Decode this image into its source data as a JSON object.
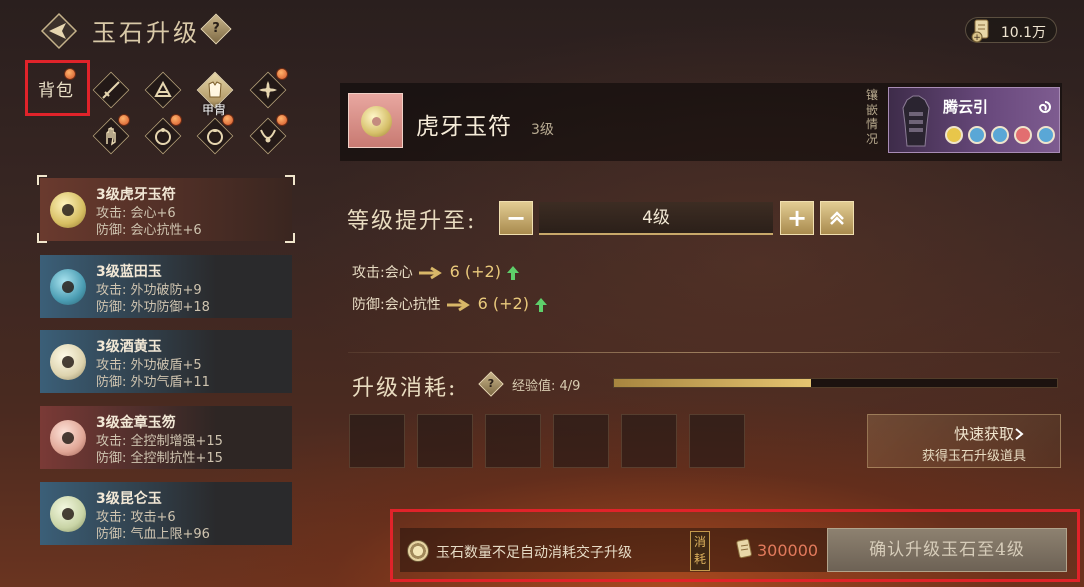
{
  "header": {
    "title": "玉石升级",
    "help_glyph": "?",
    "currency_value": "10.1万"
  },
  "categories": {
    "bag_label": "背包",
    "armor_label": "甲胄"
  },
  "jade_list": [
    {
      "name": "3级虎牙玉符",
      "attr1": "攻击: 会心+6",
      "attr2": "防御: 会心抗性+6",
      "color": "#d8c46a"
    },
    {
      "name": "3级蓝田玉",
      "attr1": "攻击: 外功破防+9",
      "attr2": "防御: 外功防御+18",
      "color": "#5fa7b8"
    },
    {
      "name": "3级酒黄玉",
      "attr1": "攻击: 外功破盾+5",
      "attr2": "防御: 外功气盾+11",
      "color": "#e5dcb8"
    },
    {
      "name": "3级金章玉笏",
      "attr1": "攻击: 全控制增强+15",
      "attr2": "防御: 全控制抗性+15",
      "color": "#e7b3a4"
    },
    {
      "name": "3级昆仑玉",
      "attr1": "攻击: 攻击+6",
      "attr2": "防御: 气血上限+96",
      "color": "#cfd8b0"
    }
  ],
  "selected": {
    "name": "虎牙玉符",
    "level": "3级"
  },
  "inlay": {
    "label": "镶嵌情况",
    "name": "腾云引",
    "socket_colors": [
      "#e8c64a",
      "#5aa7d6",
      "#5aa7d6",
      "#e26e70",
      "#5aa7d6"
    ]
  },
  "upgrade": {
    "label": "等级提升至:",
    "minus": "−",
    "plus": "+",
    "target_level": "4级",
    "stats": [
      {
        "name": "攻击:会心",
        "value": "6 (+2)"
      },
      {
        "name": "防御:会心抗性",
        "value": "6 (+2)"
      }
    ]
  },
  "cost": {
    "label": "升级消耗:",
    "exp_label": "经验值:",
    "exp_value": "4/9",
    "exp_fraction": 0.444,
    "slot_count": 6
  },
  "quick": {
    "title": "快速获取",
    "subtitle": "获得玉石升级道具"
  },
  "bottom": {
    "auto_text": "玉石数量不足自动消耗交子升级",
    "consume_tag": "消耗",
    "cost_amount": "300000",
    "confirm_label": "确认升级玉石至4级"
  }
}
